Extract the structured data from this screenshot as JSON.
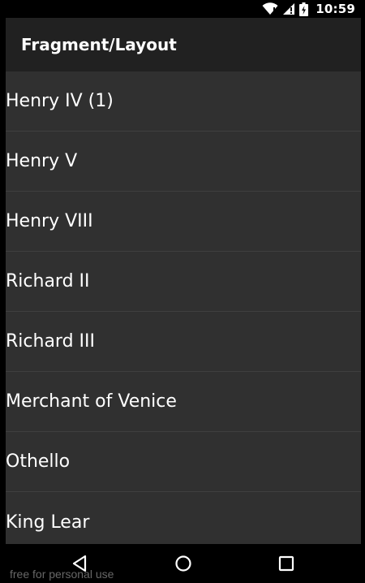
{
  "status_bar": {
    "time": "10:59",
    "icons": [
      "wifi-icon",
      "signal-icon",
      "battery-charging-icon"
    ]
  },
  "action_bar": {
    "title": "Fragment/Layout"
  },
  "list": {
    "items": [
      {
        "label": "Henry IV (1)"
      },
      {
        "label": "Henry V"
      },
      {
        "label": "Henry VIII"
      },
      {
        "label": "Richard II"
      },
      {
        "label": "Richard III"
      },
      {
        "label": "Merchant of Venice"
      },
      {
        "label": "Othello"
      },
      {
        "label": "King Lear"
      }
    ]
  },
  "nav_bar": {
    "buttons": [
      "back-icon",
      "home-icon",
      "recents-icon"
    ]
  },
  "watermark": "free for personal use",
  "colors": {
    "list_background": "#303030",
    "action_bar_background": "#212121",
    "system_bar_background": "#000000",
    "text": "#ffffff",
    "divider": "#3f3f3f"
  }
}
